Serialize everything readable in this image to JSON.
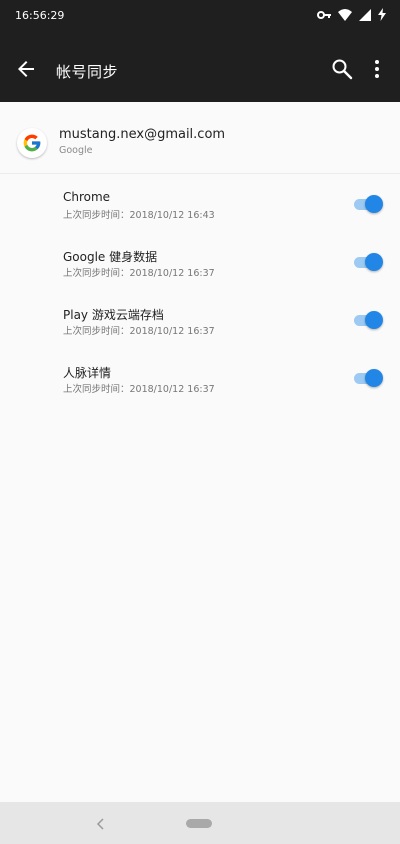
{
  "status_bar": {
    "time": "16:56:29",
    "icons": [
      "key-icon",
      "wifi-icon",
      "signal-icon",
      "battery-charging-icon"
    ]
  },
  "app_bar": {
    "title": "帐号同步",
    "icons": [
      "back-arrow-icon",
      "search-icon",
      "more-vert-icon"
    ],
    "background": "#1f1f1f"
  },
  "account": {
    "email": "mustang.nex@gmail.com",
    "provider": "Google",
    "icon": "google-logo-icon"
  },
  "sync_items": [
    {
      "name": "Chrome",
      "last_sync": "上次同步时间：2018/10/12 16:43",
      "enabled": true
    },
    {
      "name": "Google 健身数据",
      "last_sync": "上次同步时间：2018/10/12 16:37",
      "enabled": true
    },
    {
      "name": "Play 游戏云端存档",
      "last_sync": "上次同步时间：2018/10/12 16:37",
      "enabled": true
    },
    {
      "name": "人脉详情",
      "last_sync": "上次同步时间：2018/10/12 16:37",
      "enabled": true
    }
  ],
  "nav_bar": {
    "icons": [
      "nav-back-icon",
      "home-pill-icon"
    ]
  },
  "colors": {
    "accent": "#2286e6",
    "toggle_track": "#9ccaf2"
  }
}
